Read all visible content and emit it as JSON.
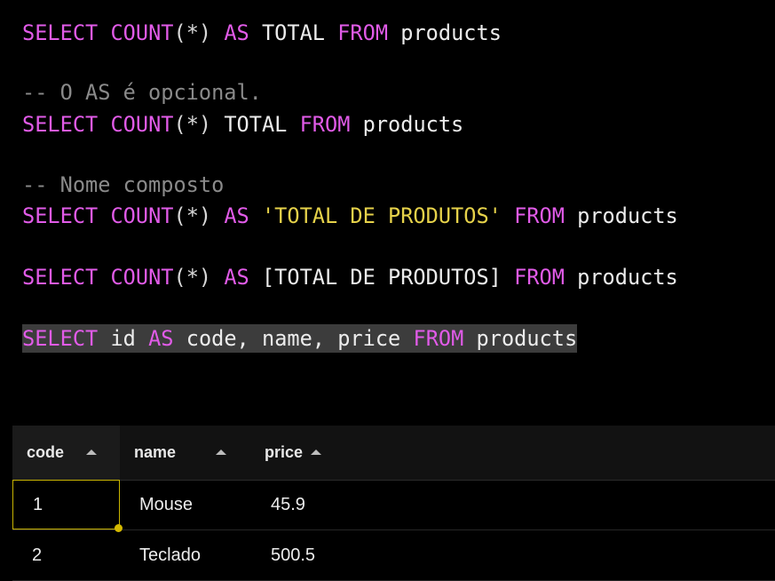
{
  "editor": {
    "line1": {
      "select": "SELECT",
      "count": "COUNT",
      "paren": "(*)",
      "as": "AS",
      "alias": "TOTAL",
      "from": "FROM",
      "table": "products"
    },
    "comment1": "-- O AS é opcional.",
    "line2": {
      "select": "SELECT",
      "count": "COUNT",
      "paren": "(*)",
      "alias": "TOTAL",
      "from": "FROM",
      "table": "products"
    },
    "comment2": "-- Nome composto",
    "line3": {
      "select": "SELECT",
      "count": "COUNT",
      "paren": "(*)",
      "as": "AS",
      "alias": "'TOTAL DE PRODUTOS'",
      "from": "FROM",
      "table": "products"
    },
    "line4": {
      "select": "SELECT",
      "count": "COUNT",
      "paren": "(*)",
      "as": "AS",
      "alias": "[TOTAL DE PRODUTOS]",
      "from": "FROM",
      "table": "products"
    },
    "line5": {
      "select": "SELECT",
      "col1": "id",
      "as": "AS",
      "alias": "code,",
      "col2": "name,",
      "col3": "price",
      "from": "FROM",
      "table": "products"
    }
  },
  "results": {
    "columns": [
      "code",
      "name",
      "price"
    ],
    "rows": [
      [
        "1",
        "Mouse",
        "45.9"
      ],
      [
        "2",
        "Teclado",
        "500.5"
      ]
    ]
  },
  "colors": {
    "keyword": "#e15be8",
    "string": "#e6d24a",
    "comment": "#8a8a8a",
    "selection": "#3c3c3c",
    "active_cell_border": "#c8b400"
  },
  "icons": {
    "sort": "sort-ascending-icon"
  }
}
